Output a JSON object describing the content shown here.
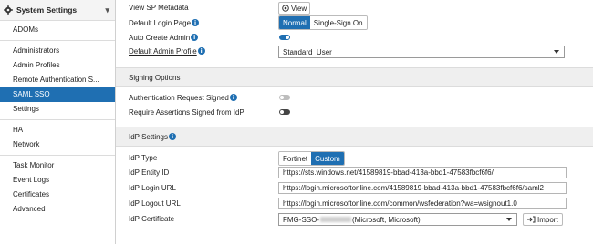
{
  "sidebar": {
    "header": "System Settings",
    "items": [
      {
        "label": "ADOMs"
      },
      {
        "label": "Administrators"
      },
      {
        "label": "Admin Profiles"
      },
      {
        "label": "Remote Authentication S..."
      },
      {
        "label": "SAML SSO"
      },
      {
        "label": "Settings"
      },
      {
        "label": "HA"
      },
      {
        "label": "Network"
      },
      {
        "label": "Task Monitor"
      },
      {
        "label": "Event Logs"
      },
      {
        "label": "Certificates"
      },
      {
        "label": "Advanced"
      }
    ]
  },
  "main": {
    "view_sp_metadata": {
      "label": "View SP Metadata",
      "button": "View"
    },
    "default_login_page": {
      "label": "Default Login Page",
      "options": [
        "Normal",
        "Single-Sign On"
      ]
    },
    "auto_create_admin": {
      "label": "Auto Create Admin"
    },
    "default_admin_profile": {
      "label": "Default Admin Profile",
      "value": "Standard_User"
    },
    "signing_options": {
      "title": "Signing Options",
      "auth_request_signed": "Authentication Request Signed",
      "require_assertions_signed": "Require Assertions Signed from IdP"
    },
    "idp_settings": {
      "title": "IdP Settings",
      "idp_type": {
        "label": "IdP Type",
        "options": [
          "Fortinet",
          "Custom"
        ]
      },
      "entity_id": {
        "label": "IdP Entity ID",
        "value": "https://sts.windows.net/41589819-bbad-413a-bbd1-47583fbcf6f6/"
      },
      "login_url": {
        "label": "IdP Login URL",
        "value": "https://login.microsoftonline.com/41589819-bbad-413a-bbd1-47583fbcf6f6/saml2"
      },
      "logout_url": {
        "label": "IdP Logout URL",
        "value": "https://login.microsoftonline.com/common/wsfederation?wa=wsignout1.0"
      },
      "certificate": {
        "label": "IdP Certificate",
        "prefix": "FMG-SSO-",
        "suffix": "(Microsoft, Microsoft)",
        "import": "Import"
      }
    }
  }
}
